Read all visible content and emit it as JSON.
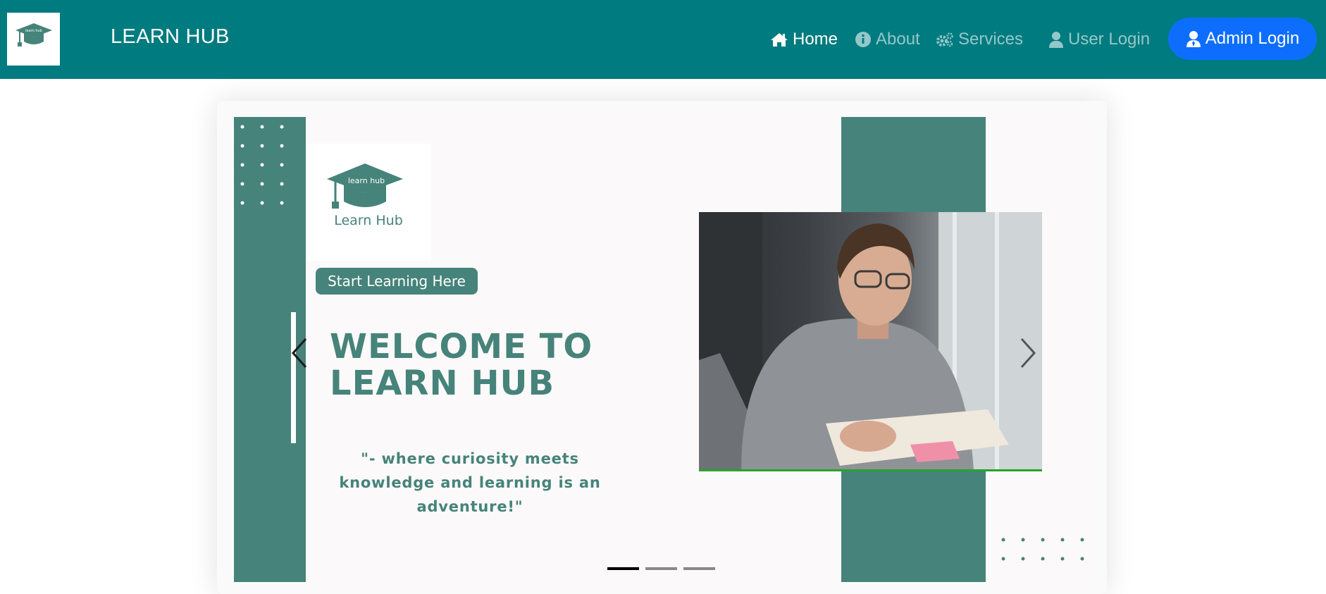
{
  "navbar": {
    "brand": "LEARN HUB",
    "logo_icon": "graduation-cap-icon",
    "links": [
      {
        "label": "Home",
        "icon": "home-icon",
        "active": true
      },
      {
        "label": "About",
        "icon": "info-icon",
        "active": false
      },
      {
        "label": "Services",
        "icon": "gears-icon",
        "active": false
      },
      {
        "label": "User Login",
        "icon": "user-icon",
        "active": false
      }
    ],
    "admin_button": {
      "label": "Admin Login",
      "icon": "admin-icon"
    }
  },
  "carousel": {
    "slide": {
      "logo_text": "Learn Hub",
      "logo_cap_text": "learn hub",
      "pill_label": "Start Learning Here",
      "heading_line1": "WELCOME TO",
      "heading_line2": "LEARN HUB",
      "quote_line1": "\"- where curiosity meets",
      "quote_line2": "knowledge and learning is an adventure!\""
    },
    "indicator_count": 3,
    "active_indicator": 0
  },
  "colors": {
    "navbar_bg": "#007b7f",
    "accent_teal": "#46837a",
    "admin_button": "#0d6efd"
  }
}
